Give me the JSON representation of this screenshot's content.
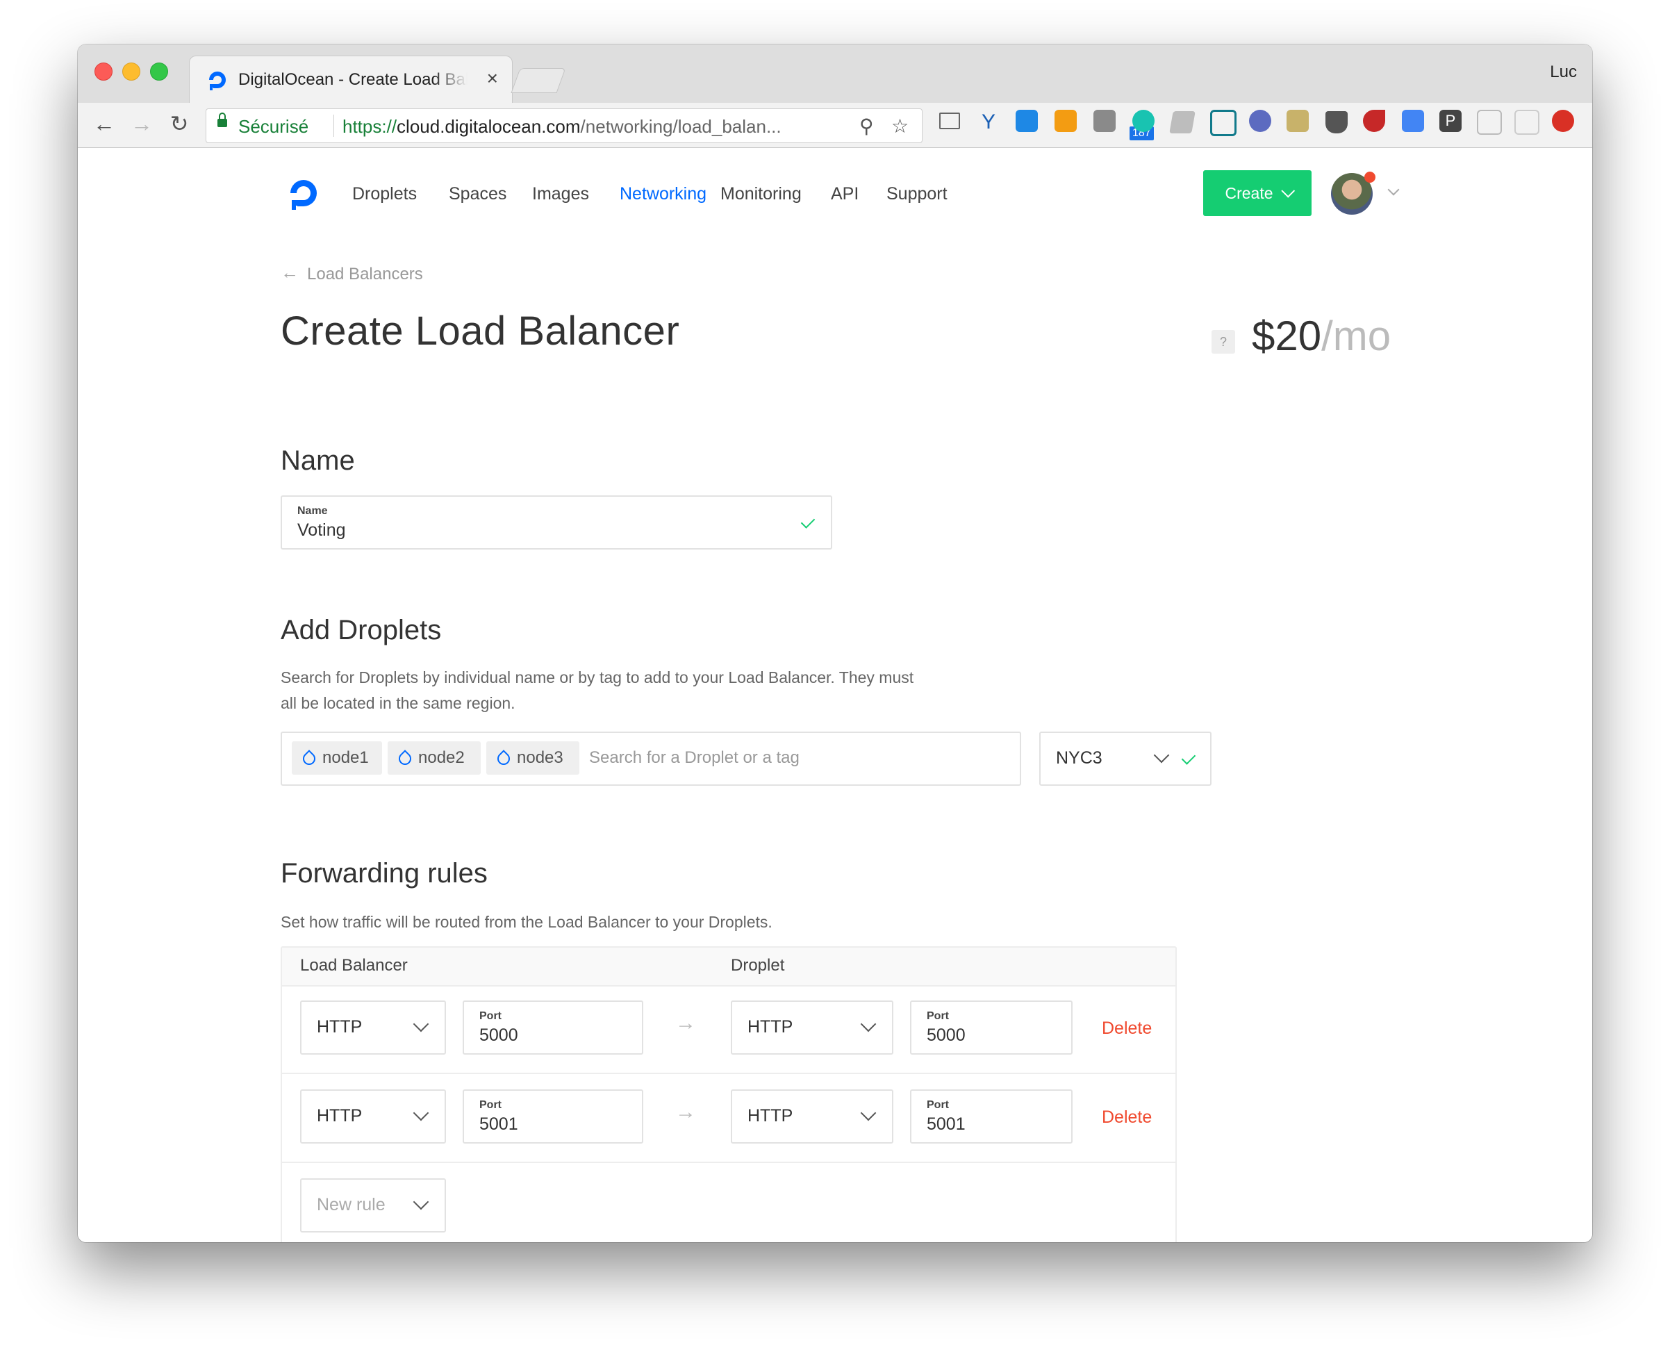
{
  "browser": {
    "tab_title": "DigitalOcean - Create Load Balancer",
    "tab_close": "×",
    "profile_name": "Luc",
    "secure_label": "Sécurisé",
    "url_scheme": "https://",
    "url_host": "cloud.digitalocean.com",
    "url_path": "/networking/load_balan...",
    "extension_badge": "187"
  },
  "nav": {
    "items": [
      "Droplets",
      "Spaces",
      "Images",
      "Networking",
      "Monitoring",
      "API",
      "Support"
    ],
    "active": "Networking",
    "create_label": "Create"
  },
  "breadcrumb": {
    "back_label": "Load Balancers"
  },
  "page": {
    "title": "Create Load Balancer",
    "price_help": "?",
    "price_amount": "$20",
    "price_period": "/mo"
  },
  "name_section": {
    "title": "Name",
    "field_label": "Name",
    "field_value": "Voting"
  },
  "droplets_section": {
    "title": "Add Droplets",
    "description_line1": "Search for Droplets by individual name or by tag to add to your Load Balancer. They must",
    "description_line2": "all be located in the same region.",
    "tags": [
      "node1",
      "node2",
      "node3"
    ],
    "search_placeholder": "Search for a Droplet or a tag",
    "region": "NYC3"
  },
  "forwarding_section": {
    "title": "Forwarding rules",
    "description": "Set how traffic will be routed from the Load Balancer to your Droplets.",
    "col_load_balancer": "Load Balancer",
    "col_droplet": "Droplet",
    "port_label": "Port",
    "delete_label": "Delete",
    "rules": [
      {
        "lb_protocol": "HTTP",
        "lb_port": "5000",
        "droplet_protocol": "HTTP",
        "droplet_port": "5000"
      },
      {
        "lb_protocol": "HTTP",
        "lb_port": "5001",
        "droplet_protocol": "HTTP",
        "droplet_port": "5001"
      }
    ],
    "new_rule_placeholder": "New rule"
  },
  "colors": {
    "accent_blue": "#0069ff",
    "create_green": "#15cd72",
    "delete_red": "#f04a2f"
  }
}
